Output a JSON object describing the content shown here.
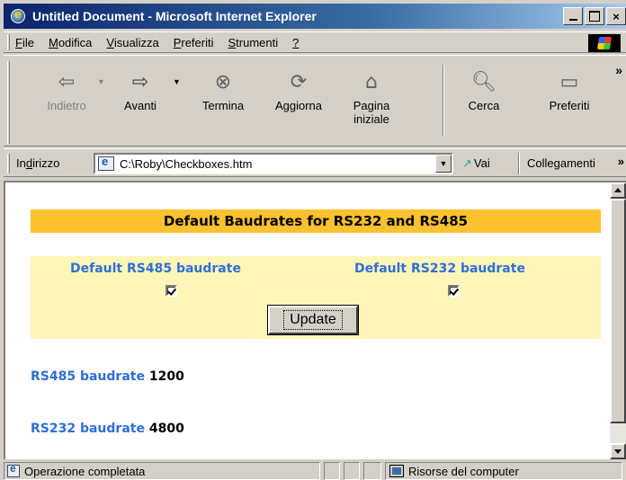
{
  "window": {
    "title": "Untitled Document - Microsoft Internet Explorer",
    "controls": {
      "close": "×"
    }
  },
  "menu": {
    "items": [
      {
        "label": "File",
        "accel": "F",
        "rest": "ile"
      },
      {
        "label": "Modifica",
        "accel": "M",
        "rest": "odifica"
      },
      {
        "label": "Visualizza",
        "accel": "V",
        "rest": "isualizza"
      },
      {
        "label": "Preferiti",
        "accel": "P",
        "rest": "referiti"
      },
      {
        "label": "Strumenti",
        "accel": "S",
        "rest": "trumenti"
      },
      {
        "label": "?",
        "accel": "?",
        "rest": ""
      }
    ]
  },
  "toolbar": {
    "back": "Indietro",
    "forward": "Avanti",
    "stop": "Termina",
    "refresh": "Aggiorna",
    "home_line1": "Pagina",
    "home_line2": "iniziale",
    "search": "Cerca",
    "favorites": "Preferiti",
    "more": "»"
  },
  "address": {
    "label_pre": "In",
    "label_accel": "d",
    "label_post": "irizzo",
    "url": "C:\\Roby\\Checkboxes.htm",
    "go": "Vai",
    "links": "Collegamenti",
    "more": "»"
  },
  "page": {
    "banner": "Default Baudrates for RS232 and RS485",
    "rs485_default_label": "Default RS485 baudrate",
    "rs232_default_label": "Default RS232 baudrate",
    "rs485_default_checked": true,
    "rs232_default_checked": true,
    "update_button": "Update",
    "rs485_label": "RS485 baudrate",
    "rs485_value": "1200",
    "rs232_label": "RS232 baudrate",
    "rs232_value": "4800"
  },
  "status": {
    "text": "Operazione completata",
    "zone": "Risorse del computer"
  },
  "colors": {
    "title_gradient_start": "#0a246a",
    "banner_bg": "#fbc12e",
    "panel_bg": "#fdf6b8",
    "label_blue": "#2e6fd8",
    "chrome": "#d4d0c8"
  }
}
